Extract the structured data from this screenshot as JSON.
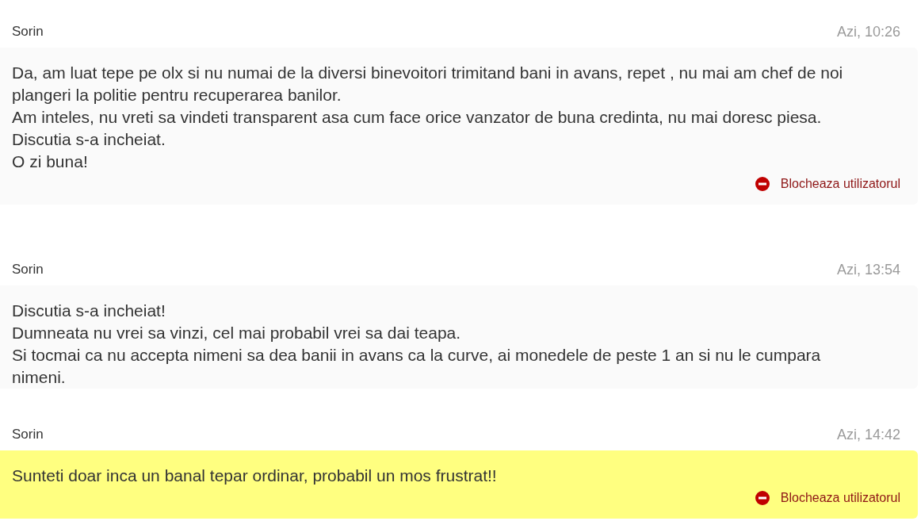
{
  "messages": [
    {
      "sender": "Sorin",
      "time": "Azi, 10:26",
      "highlighted": false,
      "paragraphs": [
        "Da, am luat tepe pe olx si nu numai de la diversi binevoitori trimitand bani in avans, repet , nu mai am chef de noi plangeri la politie pentru recuperarea banilor.",
        "Am inteles, nu vreti sa vindeti transparent asa cum face orice vanzator de buna credinta, nu mai doresc piesa.",
        "Discutia s-a incheiat.",
        "O zi buna!"
      ],
      "action": "Blocheaza utilizatorul"
    },
    {
      "sender": "Sorin",
      "time": "Azi, 13:54",
      "highlighted": false,
      "paragraphs": [
        "Discutia s-a incheiat!",
        "Dumneata nu vrei sa vinzi, cel mai probabil vrei sa dai teapa.",
        "Si tocmai ca nu accepta nimeni sa dea banii in avans ca la curve, ai monedele de peste 1 an si nu le cumpara nimeni."
      ]
    },
    {
      "sender": "Sorin",
      "time": "Azi, 14:42",
      "highlighted": true,
      "paragraphs": [
        "Sunteti doar inca un banal tepar ordinar, probabil un mos frustrat!!"
      ],
      "action": "Blocheaza utilizatorul"
    }
  ]
}
